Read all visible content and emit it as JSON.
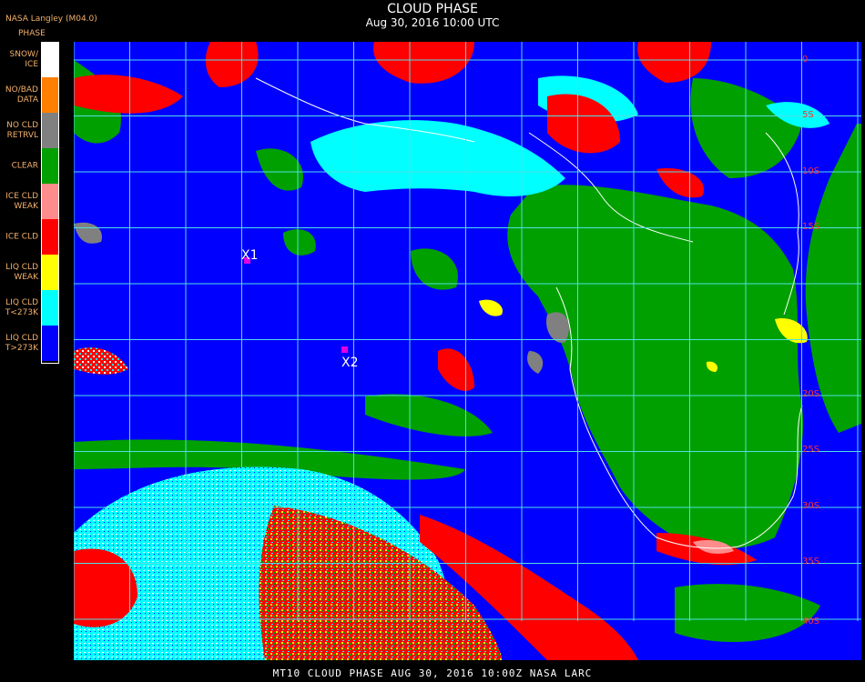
{
  "header": {
    "title": "CLOUD PHASE",
    "subtitle": "Aug 30, 2016 10:00 UTC",
    "producer": "NASA Langley (M04.0)"
  },
  "legend": {
    "title": "PHASE",
    "items": [
      {
        "label": "SNOW/\nICE",
        "color": "#ffffff"
      },
      {
        "label": "NO/BAD\nDATA",
        "color": "#ff7f00"
      },
      {
        "label": "NO CLD\nRETRVL",
        "color": "#808080"
      },
      {
        "label": "CLEAR",
        "color": "#00a000"
      },
      {
        "label": "ICE CLD\nWEAK",
        "color": "#ff8c8c"
      },
      {
        "label": "ICE CLD",
        "color": "#ff0000"
      },
      {
        "label": "LIQ CLD\nWEAK",
        "color": "#ffff00"
      },
      {
        "label": "LIQ CLD\nT<273K",
        "color": "#00ffff"
      },
      {
        "label": "LIQ CLD\nT>273K",
        "color": "#0000ff"
      }
    ]
  },
  "map": {
    "background_color": "#0000ff",
    "grid_color": "#50e0e0",
    "coast_color": "#ffffff",
    "lat_labels": [
      "0",
      "5S",
      "10S",
      "15S",
      "20S",
      "25S",
      "30S",
      "35S",
      "40S"
    ],
    "markers": [
      {
        "label": "X1",
        "color": "#e000e0"
      },
      {
        "label": "X2",
        "color": "#e000e0"
      }
    ]
  },
  "footer": {
    "text": "MT10  CLOUD PHASE   AUG 30, 2016 10:00Z   NASA LARC"
  }
}
